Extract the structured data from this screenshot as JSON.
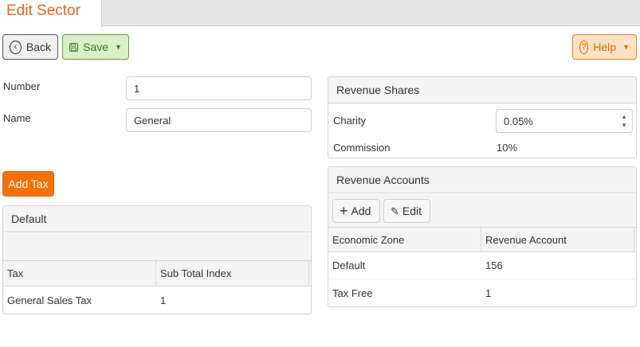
{
  "tab": {
    "title": "Edit Sector"
  },
  "toolbar": {
    "back_label": "Back",
    "save_label": "Save",
    "help_label": "Help"
  },
  "form": {
    "number_label": "Number",
    "number_value": "1",
    "name_label": "Name",
    "name_value": "General"
  },
  "revenue_shares": {
    "title": "Revenue Shares",
    "charity_label": "Charity",
    "charity_value": "0.05%",
    "commission_label": "Commission",
    "commission_value": "10%"
  },
  "add_tax_label": "Add Tax",
  "default_panel": {
    "title": "Default",
    "columns": [
      "Tax",
      "Sub Total Index"
    ],
    "rows": [
      {
        "tax": "General Sales Tax",
        "index": "1"
      }
    ]
  },
  "revenue_accounts": {
    "title": "Revenue Accounts",
    "add_label": "Add",
    "edit_label": "Edit",
    "columns": [
      "Economic Zone",
      "Revenue Account"
    ],
    "rows": [
      {
        "zone": "Default",
        "account": "156"
      },
      {
        "zone": "Tax Free",
        "account": "1"
      }
    ]
  },
  "colors": {
    "accent": "#e8671b",
    "add_tax": "#f57200",
    "save": "#d8efc8",
    "help": "#fde3c4"
  }
}
